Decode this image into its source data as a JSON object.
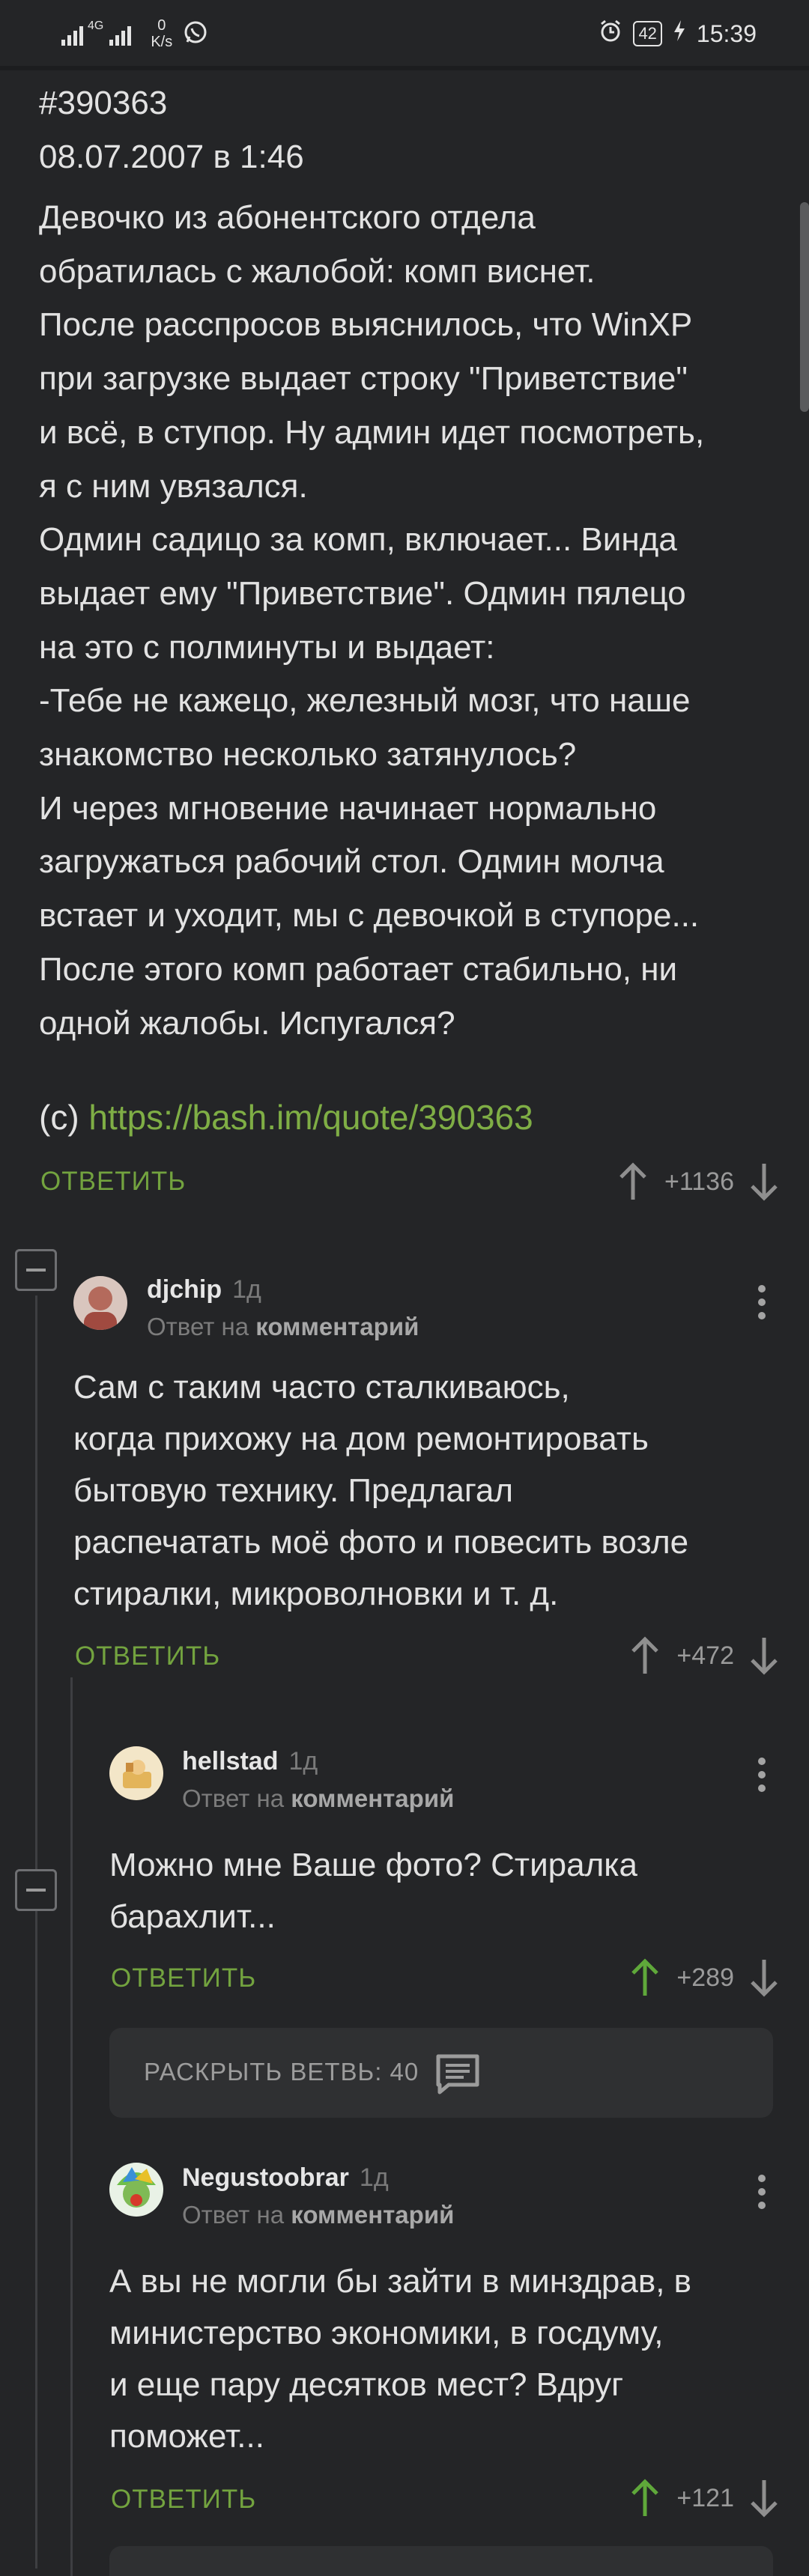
{
  "status_bar": {
    "network": "4G",
    "net_rate": "0",
    "net_rate_unit": "K/s",
    "battery": "42",
    "time": "15:39"
  },
  "post": {
    "id": "#390363",
    "date": "08.07.2007 в 1:46",
    "lines": [
      "Девочко из абонентского отдела",
      "обратилась с жалобой: комп виснет.",
      "После расспросов выяснилось, что WinXP",
      "при загрузке выдает строку \"Приветствие\"",
      "и всё, в ступор. Ну админ идет посмотреть,",
      "я с ним увязался.",
      "Одмин садицо за комп, включает... Винда",
      "выдает ему \"Приветствие\". Одмин пялецо",
      "на это с полминуты и выдает:",
      "-Тебе не кажецо, железный мозг, что наше",
      "знакомство несколько затянулось?",
      "И через мгновение начинает нормально",
      "загружаться рабочий стол. Одмин молча",
      "встает и уходит, мы с девочкой в ступоре...",
      "После этого комп работает стабильно, ни",
      "одной жалобы. Испугался?"
    ],
    "source_prefix": "(c) ",
    "source_link": "https://bash.im/quote/390363",
    "reply_label": "ОТВЕТИТЬ",
    "rating": "+1136"
  },
  "comments": [
    {
      "user": "djchip",
      "ago": "1д",
      "reply_prefix": "Ответ на",
      "reply_target": "комментарий",
      "lines": [
        "Сам с таким часто сталкиваюсь,",
        "когда прихожу на дом ремонтировать",
        "бытовую технику. Предлагал",
        "распечатать моё фото и повесить возле",
        "стиралки, микроволновки и т. д."
      ],
      "reply_label": "ОТВЕТИТЬ",
      "rating": "+472"
    },
    {
      "user": "hellstad",
      "ago": "1д",
      "reply_prefix": "Ответ на",
      "reply_target": "комментарий",
      "lines": [
        "Можно мне Ваше фото? Стиралка",
        "барахлит..."
      ],
      "reply_label": "ОТВЕТИТЬ",
      "rating": "+289"
    },
    {
      "user": "Negustoobrar",
      "ago": "1д",
      "reply_prefix": "Ответ на",
      "reply_target": "комментарий",
      "lines": [
        "А вы не могли бы зайти в минздрав, в",
        "министерство экономики, в госдуму,",
        "и еще пару десятков мест? Вдруг",
        "поможет..."
      ],
      "reply_label": "ОТВЕТИТЬ",
      "rating": "+121"
    }
  ],
  "expand_branch": {
    "label": "РАСКРЫТЬ ВЕТВЬ: 40"
  },
  "colors": {
    "background": "#242527",
    "accent_green": "#73a33f",
    "link_green": "#7fae45",
    "upvoted_green": "#5fa83a",
    "muted_text": "#7c7c7c"
  },
  "icons": [
    "signal-icon",
    "whatsapp-icon",
    "alarm-icon",
    "battery-icon",
    "charging-icon",
    "upvote-icon",
    "downvote-icon",
    "more-options-icon",
    "collapse-icon",
    "comments-icon"
  ]
}
